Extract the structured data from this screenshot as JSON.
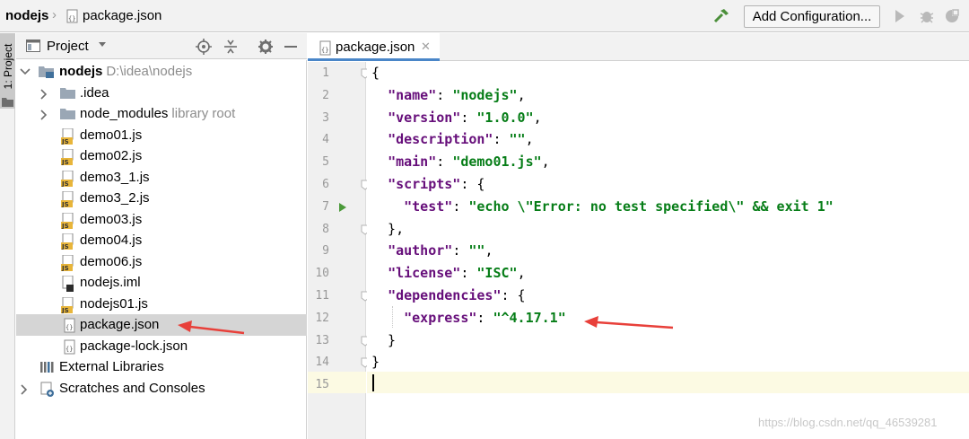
{
  "breadcrumb": {
    "root": "nodejs",
    "file": "package.json"
  },
  "toolbar": {
    "add_configuration": "Add Configuration..."
  },
  "stripe": {
    "project_tab": "1: Project"
  },
  "project_panel": {
    "title": "Project",
    "tree": [
      {
        "label": "nodejs",
        "hint": "D:\\idea\\nodejs",
        "icon": "project-folder-icon",
        "expanded": true,
        "bold": true
      },
      {
        "label": ".idea",
        "icon": "folder-icon",
        "expanded": false
      },
      {
        "label": "node_modules",
        "hint": "library root",
        "icon": "folder-icon",
        "expanded": false
      },
      {
        "label": "demo01.js",
        "icon": "js-file-icon"
      },
      {
        "label": "demo02.js",
        "icon": "js-file-icon"
      },
      {
        "label": "demo3_1.js",
        "icon": "js-file-icon"
      },
      {
        "label": "demo3_2.js",
        "icon": "js-file-icon"
      },
      {
        "label": "demo03.js",
        "icon": "js-file-icon"
      },
      {
        "label": "demo04.js",
        "icon": "js-file-icon"
      },
      {
        "label": "demo06.js",
        "icon": "js-file-icon"
      },
      {
        "label": "nodejs.iml",
        "icon": "iml-file-icon"
      },
      {
        "label": "nodejs01.js",
        "icon": "js-file-icon"
      },
      {
        "label": "package.json",
        "icon": "json-file-icon",
        "selected": true
      },
      {
        "label": "package-lock.json",
        "icon": "json-file-icon"
      },
      {
        "label": "External Libraries",
        "icon": "libraries-icon"
      },
      {
        "label": "Scratches and Consoles",
        "icon": "scratches-icon",
        "expanded": false
      }
    ]
  },
  "editor": {
    "tab_label": "package.json",
    "line_numbers": [
      "1",
      "2",
      "3",
      "4",
      "5",
      "6",
      "7",
      "8",
      "9",
      "10",
      "11",
      "12",
      "13",
      "14",
      "15"
    ],
    "lines": [
      [
        {
          "t": "{",
          "c": "p"
        }
      ],
      [
        {
          "t": "  ",
          "c": "p"
        },
        {
          "t": "\"name\"",
          "c": "k"
        },
        {
          "t": ": ",
          "c": "p"
        },
        {
          "t": "\"nodejs\"",
          "c": "s"
        },
        {
          "t": ",",
          "c": "p"
        }
      ],
      [
        {
          "t": "  ",
          "c": "p"
        },
        {
          "t": "\"version\"",
          "c": "k"
        },
        {
          "t": ": ",
          "c": "p"
        },
        {
          "t": "\"1.0.0\"",
          "c": "s"
        },
        {
          "t": ",",
          "c": "p"
        }
      ],
      [
        {
          "t": "  ",
          "c": "p"
        },
        {
          "t": "\"description\"",
          "c": "k"
        },
        {
          "t": ": ",
          "c": "p"
        },
        {
          "t": "\"\"",
          "c": "s"
        },
        {
          "t": ",",
          "c": "p"
        }
      ],
      [
        {
          "t": "  ",
          "c": "p"
        },
        {
          "t": "\"main\"",
          "c": "k"
        },
        {
          "t": ": ",
          "c": "p"
        },
        {
          "t": "\"demo01.js\"",
          "c": "s"
        },
        {
          "t": ",",
          "c": "p"
        }
      ],
      [
        {
          "t": "  ",
          "c": "p"
        },
        {
          "t": "\"scripts\"",
          "c": "k"
        },
        {
          "t": ": {",
          "c": "p"
        }
      ],
      [
        {
          "t": "    ",
          "c": "p"
        },
        {
          "t": "\"test\"",
          "c": "k"
        },
        {
          "t": ": ",
          "c": "p"
        },
        {
          "t": "\"echo \\\"Error: no test specified\\\" && exit 1\"",
          "c": "s"
        }
      ],
      [
        {
          "t": "  },",
          "c": "p"
        }
      ],
      [
        {
          "t": "  ",
          "c": "p"
        },
        {
          "t": "\"author\"",
          "c": "k"
        },
        {
          "t": ": ",
          "c": "p"
        },
        {
          "t": "\"\"",
          "c": "s"
        },
        {
          "t": ",",
          "c": "p"
        }
      ],
      [
        {
          "t": "  ",
          "c": "p"
        },
        {
          "t": "\"license\"",
          "c": "k"
        },
        {
          "t": ": ",
          "c": "p"
        },
        {
          "t": "\"ISC\"",
          "c": "s"
        },
        {
          "t": ",",
          "c": "p"
        }
      ],
      [
        {
          "t": "  ",
          "c": "p"
        },
        {
          "t": "\"dependencies\"",
          "c": "k"
        },
        {
          "t": ": {",
          "c": "p"
        }
      ],
      [
        {
          "t": "    ",
          "c": "p"
        },
        {
          "t": "\"express\"",
          "c": "k"
        },
        {
          "t": ": ",
          "c": "p"
        },
        {
          "t": "\"^4.17.1\"",
          "c": "s"
        }
      ],
      [
        {
          "t": "  }",
          "c": "p"
        }
      ],
      [
        {
          "t": "}",
          "c": "p"
        }
      ],
      [
        {
          "t": "",
          "c": "p"
        }
      ]
    ],
    "current_line": 15
  },
  "watermark": "https://blog.csdn.net/qq_46539281",
  "colors": {
    "json_key": "#660e7a",
    "json_string": "#067d17",
    "selection": "#d5d5d5",
    "annotation_arrow": "#e8403a",
    "tab_underline": "#4a86c8"
  }
}
